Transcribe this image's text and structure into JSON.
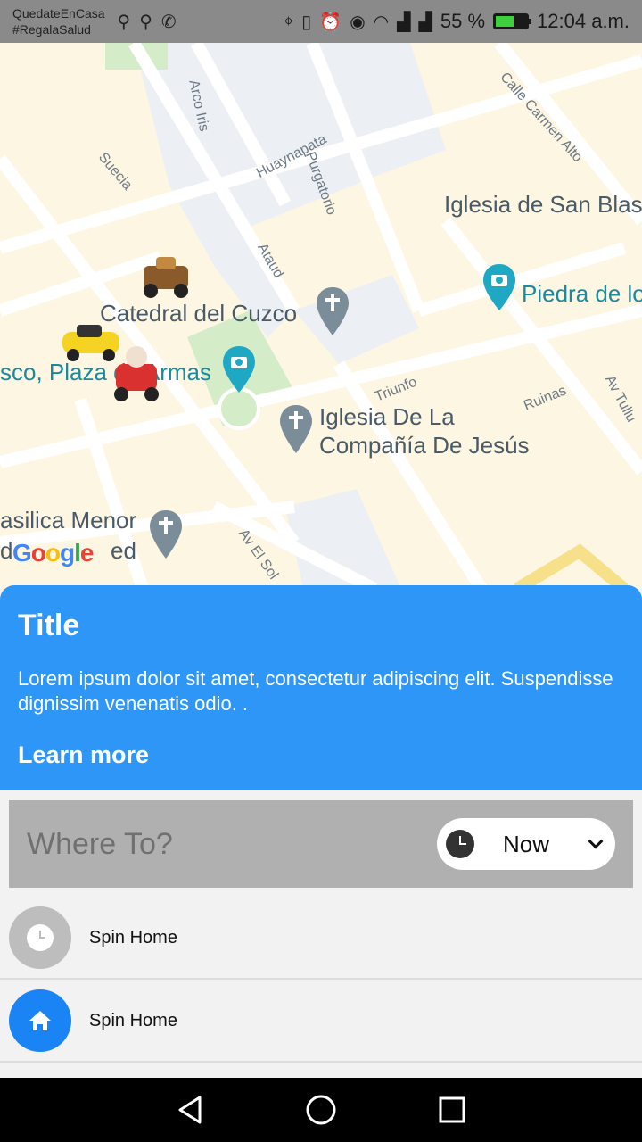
{
  "status_bar": {
    "line1": "QuedateEnCasa",
    "line2": "#RegalaSalud",
    "battery_percent": "55 %",
    "time": "12:04 a.m.",
    "battery_level": 0.55
  },
  "map": {
    "street_labels": [
      "Arco Iris",
      "Suecia",
      "Huaynapata",
      "Purgatorio",
      "Ataud",
      "Calle Carmen Alto",
      "Triunfo",
      "Ruinas",
      "Av El Sol",
      "Av Tullu"
    ],
    "pois": {
      "iglesia_san_blas": "Iglesia de San Blas",
      "piedra": "Piedra de lo",
      "catedral": "Catedral del Cuzco",
      "plaza": "sco, Plaza de Armas",
      "compania_line1": "Iglesia De La",
      "compania_line2": "Compañía De Jesús",
      "basilica_line1": "asilica Menor",
      "basilica_line2": "d",
      "basilica_line3": "ed"
    },
    "logo_letters": [
      "G",
      "o",
      "o",
      "g",
      "l",
      "e"
    ]
  },
  "info_card": {
    "title": "Title",
    "body": "Lorem ipsum dolor sit amet, consectetur adipiscing elit. Suspendisse dignissim venenatis odio. .",
    "link": "Learn more",
    "color": "#2d96f7"
  },
  "search": {
    "placeholder": "Where To?",
    "time_option": "Now"
  },
  "list": [
    {
      "label": "Spin Home",
      "icon": "clock-icon"
    },
    {
      "label": "Spin Home",
      "icon": "home-icon"
    }
  ]
}
